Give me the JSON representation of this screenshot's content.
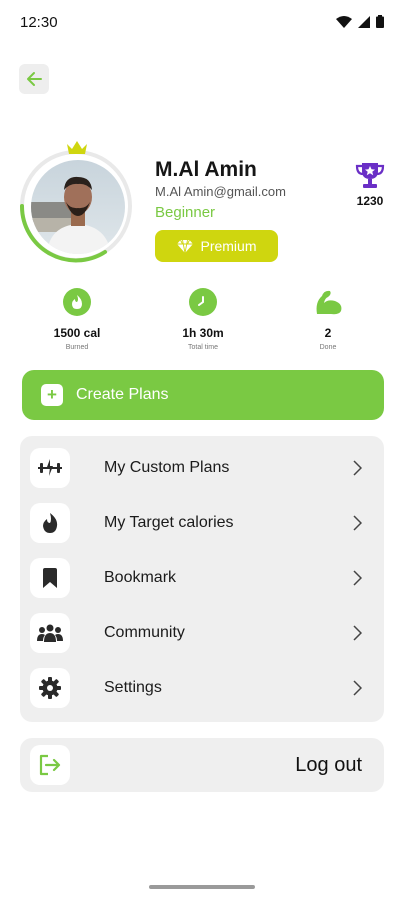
{
  "status": {
    "time": "12:30"
  },
  "profile": {
    "name": "M.Al Amin",
    "email": "M.Al Amin@gmail.com",
    "level": "Beginner",
    "badge": "Premium",
    "points": "1230"
  },
  "stats": [
    {
      "value": "1500 cal",
      "label": "Burned",
      "icon": "flame-icon"
    },
    {
      "value": "1h 30m",
      "label": "Total time",
      "icon": "clock-icon"
    },
    {
      "value": "2",
      "label": "Done",
      "icon": "muscle-icon"
    }
  ],
  "create_plans": {
    "label": "Create Plans"
  },
  "menu": [
    {
      "label": "My Custom Plans",
      "icon": "dumbbell-icon"
    },
    {
      "label": "My Target calories",
      "icon": "flame-icon"
    },
    {
      "label": "Bookmark",
      "icon": "bookmark-icon"
    },
    {
      "label": "Community",
      "icon": "community-icon"
    },
    {
      "label": "Settings",
      "icon": "gear-icon"
    }
  ],
  "logout": {
    "label": "Log out"
  },
  "colors": {
    "accent": "#7ac943",
    "premium": "#cfd60f",
    "trophy": "#6a2fc6",
    "card": "#efefef"
  }
}
